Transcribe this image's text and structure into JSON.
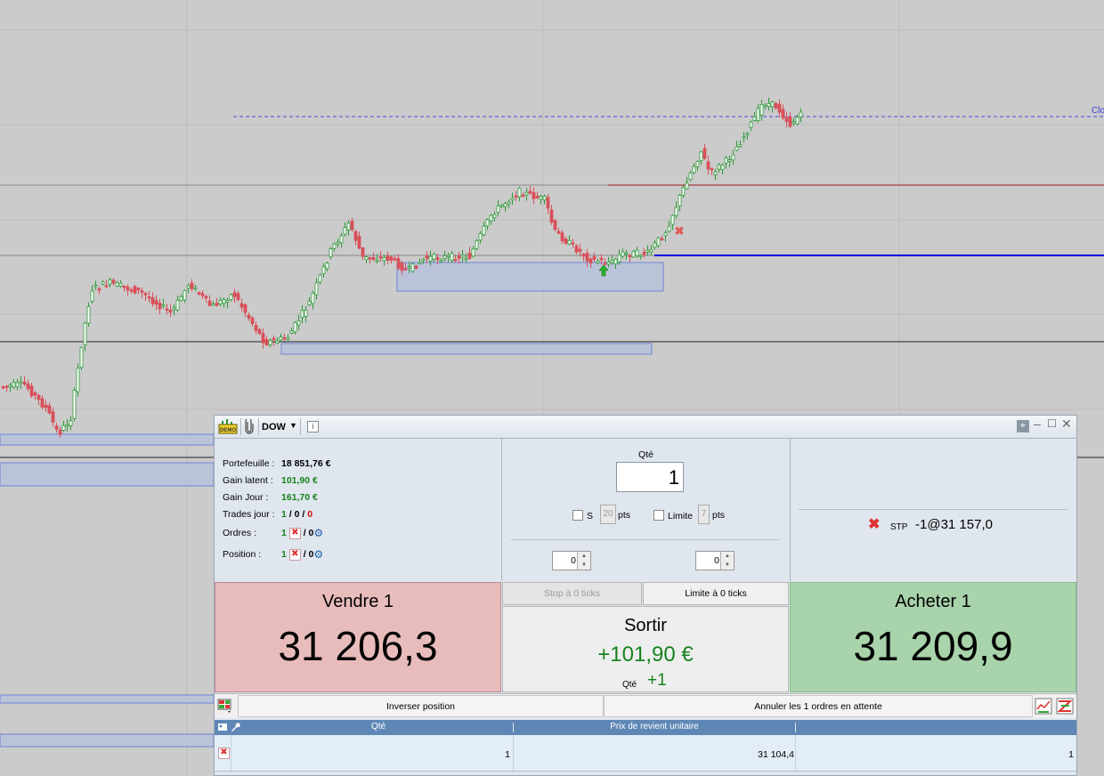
{
  "chart": {
    "close_label": "Clo",
    "colors": {
      "up": "#2f9a3a",
      "down": "#d9505a",
      "bull_body": "#ffffff",
      "bear_body": "#d9505a",
      "zone": "#b9c2dc",
      "zone_border": "#6f86d6",
      "target_line": "#a01818",
      "order_line": "#0000e0"
    }
  },
  "panel": {
    "titlebar": {
      "symbol": "DOW",
      "demo_icon": "demo-icon",
      "clip_icon": "paperclip-icon",
      "info_icon": "info-icon",
      "pin_icon": "pin-icon"
    },
    "info": {
      "portfolio_label": "Portefeuille :",
      "portfolio_value": "18 851,76 €",
      "latent_label": "Gain latent :",
      "latent_value": "101,90 €",
      "day_label": "Gain Jour :",
      "day_value": "161,70 €",
      "trades_label": "Trades jour :",
      "trades_a": "1",
      "trades_sep1": " / ",
      "trades_b": "0",
      "trades_sep2": " / ",
      "trades_c": "0",
      "orders_label": "Ordres :",
      "orders_count": "1",
      "orders_slash": "/ 0",
      "position_label": "Position :",
      "position_count": "1",
      "position_slash": "/ 0"
    },
    "qty": {
      "label": "Qté",
      "value": "1"
    },
    "options": {
      "stop_label": "S",
      "stop_pts": "20",
      "pts_label": "pts",
      "limit_label": "Limite",
      "limit_pts": "7",
      "pts_label2": "pts",
      "spin_left": "0",
      "spin_right": "0"
    },
    "pending": {
      "type": "STP",
      "order": "-1@31 157,0"
    },
    "sell": {
      "title": "Vendre 1",
      "price": "31 206,3"
    },
    "buy": {
      "title": "Acheter 1",
      "price": "31 209,9"
    },
    "stop_tab": "Stop à 0 ticks",
    "limit_tab": "Limite à 0 ticks",
    "exit": {
      "title": "Sortir",
      "gain": "+101,90 €",
      "qty_label": "Qté",
      "qty": "+1"
    },
    "actions": {
      "reverse": "Inverser position",
      "cancel": "Annuler les 1 ordres en attente"
    },
    "table": {
      "headers": [
        "Qté",
        "Prix de revient unitaire",
        ""
      ],
      "rows": [
        {
          "qty": "1",
          "price": "31 104,4",
          "last": "1"
        }
      ]
    }
  }
}
